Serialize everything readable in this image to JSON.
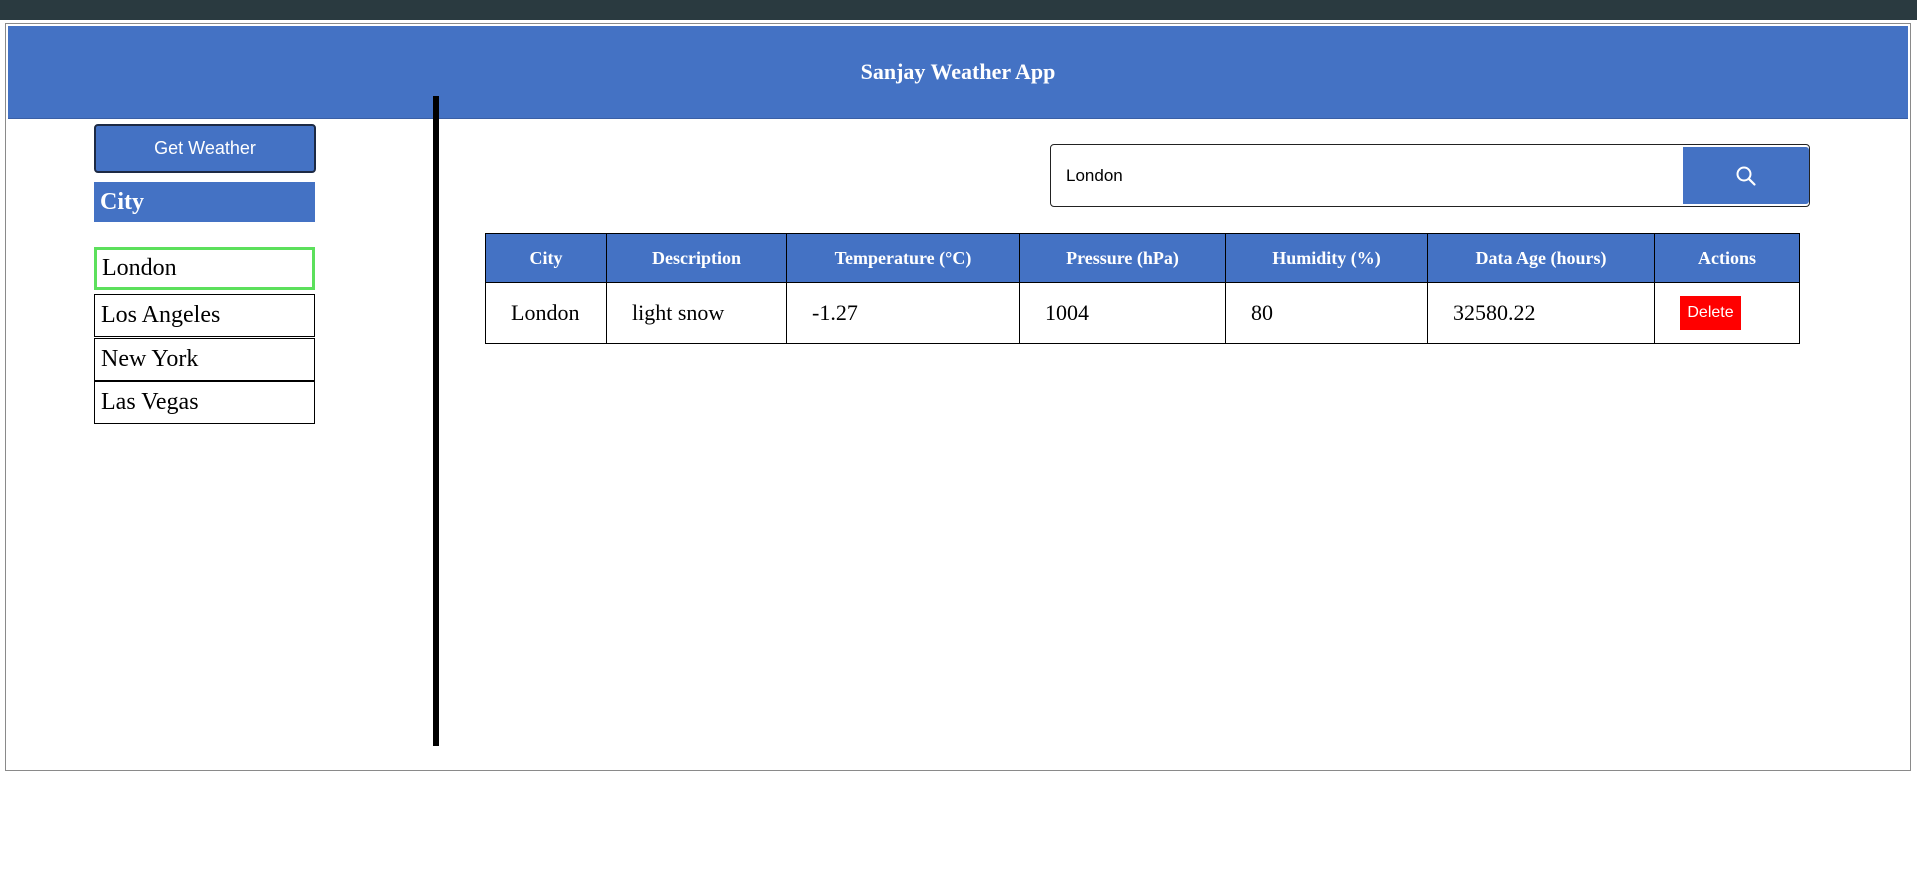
{
  "app": {
    "title": "Sanjay Weather App"
  },
  "sidebar": {
    "get_weather_label": "Get Weather",
    "city_header": "City",
    "cities": [
      {
        "label": "London",
        "selected": true
      },
      {
        "label": "Los Angeles",
        "selected": false
      },
      {
        "label": "New York",
        "selected": false
      },
      {
        "label": "Las Vegas",
        "selected": false
      }
    ]
  },
  "search": {
    "value": "London",
    "icon": "search-icon"
  },
  "table": {
    "headers": [
      "City",
      "Description",
      "Temperature (°C)",
      "Pressure (hPa)",
      "Humidity (%)",
      "Data Age (hours)",
      "Actions"
    ],
    "rows": [
      {
        "city": "London",
        "description": "light snow",
        "temperature": "-1.27",
        "pressure": "1004",
        "humidity": "80",
        "data_age": "32580.22",
        "action_label": "Delete"
      }
    ]
  },
  "colors": {
    "primary": "#4472c4",
    "danger": "#ff0000",
    "selected_border": "#5ce05c"
  }
}
